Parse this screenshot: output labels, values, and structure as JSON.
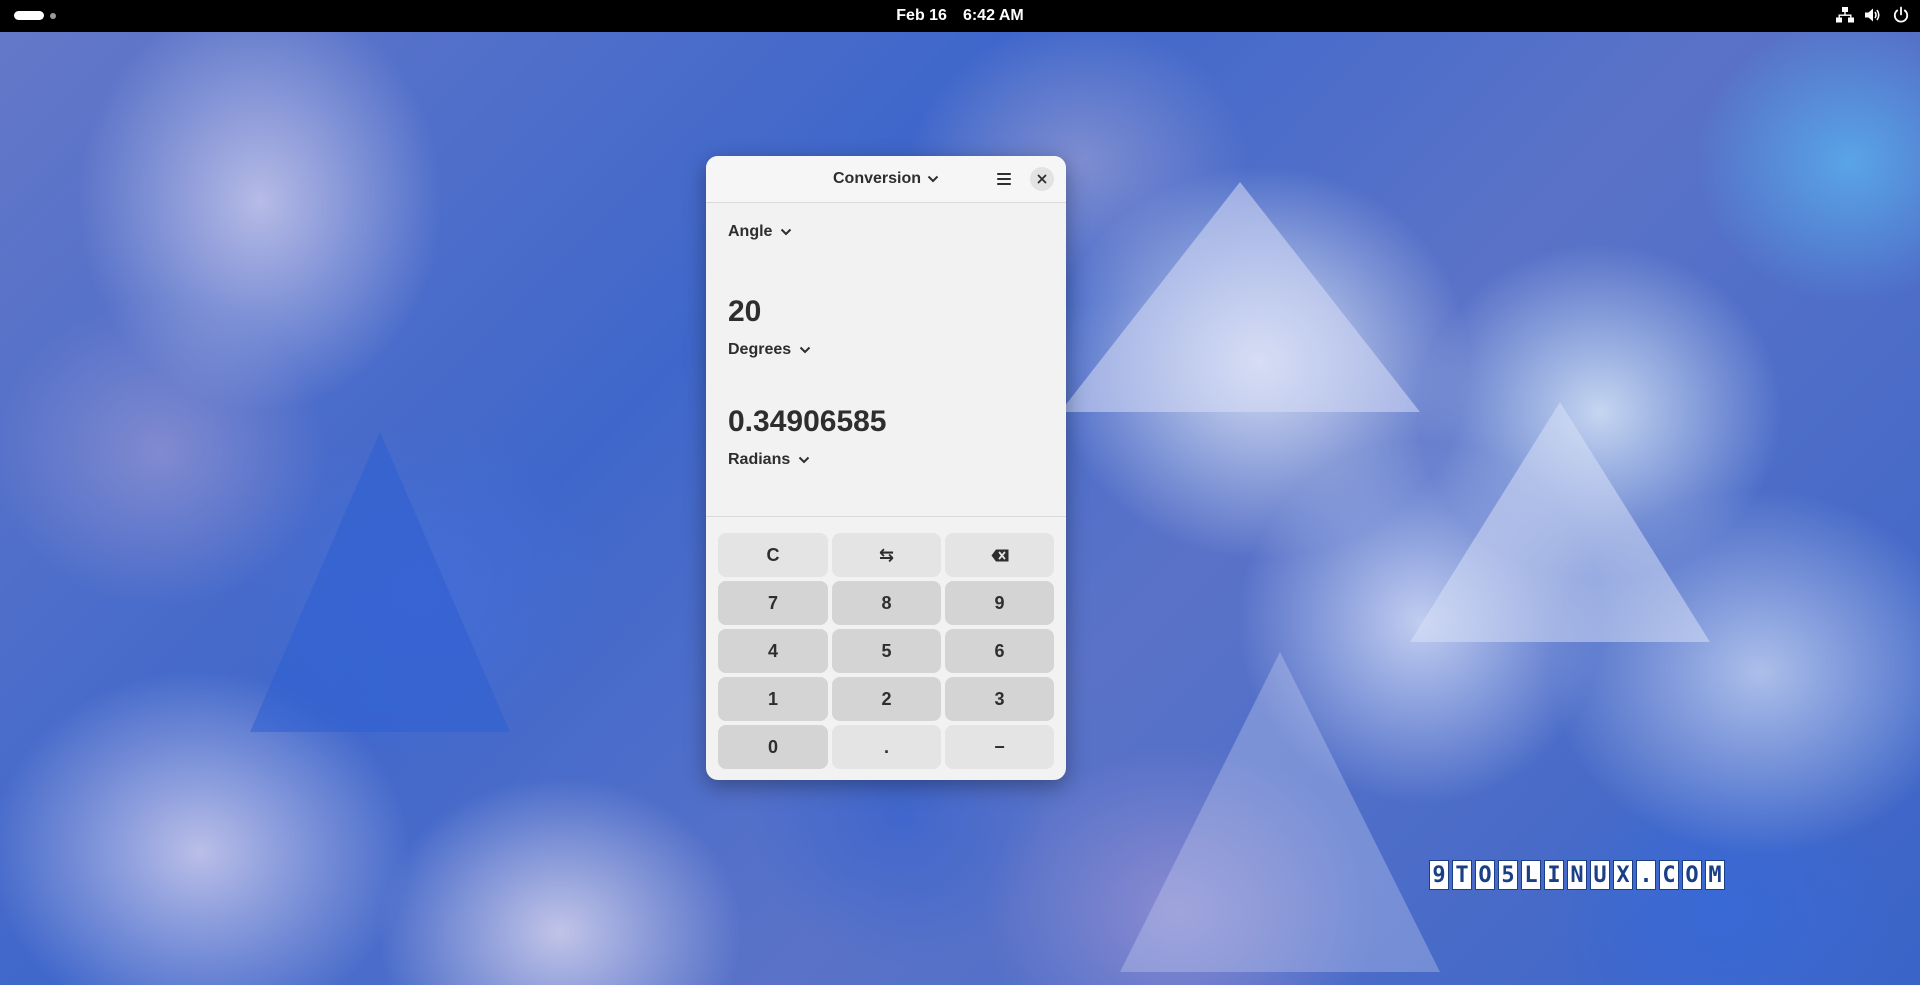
{
  "topbar": {
    "date": "Feb 16",
    "time": "6:42 AM",
    "icons": [
      "network-icon",
      "volume-icon",
      "power-icon"
    ]
  },
  "calculator": {
    "mode": "Conversion",
    "category": "Angle",
    "from_value": "20",
    "from_unit": "Degrees",
    "to_value": "0.34906585",
    "to_unit": "Radians",
    "keys": [
      "C",
      "⇆",
      "⌫",
      "7",
      "8",
      "9",
      "4",
      "5",
      "6",
      "1",
      "2",
      "3",
      "0",
      ".",
      "−"
    ]
  },
  "watermark": {
    "text": "9TO5LINUX.COM",
    "chars": [
      "9",
      "T",
      "O",
      "5",
      "L",
      "I",
      "N",
      "U",
      "X",
      ".",
      "C",
      "O",
      "M"
    ]
  },
  "colors": {
    "topbar": "#000000",
    "window_bg": "#f2f2f2",
    "key_light": "#e4e4e4",
    "key_dark": "#d4d4d4",
    "watermark_blue": "#1a3f86"
  }
}
